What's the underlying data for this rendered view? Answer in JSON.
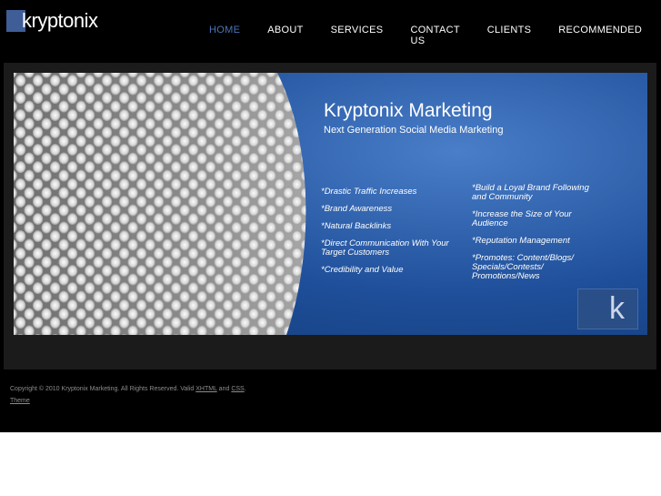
{
  "logo": {
    "text": "kryptonix"
  },
  "nav": {
    "items": [
      {
        "label": "HOME"
      },
      {
        "label": "ABOUT"
      },
      {
        "label": "SERVICES"
      },
      {
        "label": "CONTACT US"
      },
      {
        "label": "CLIENTS"
      },
      {
        "label": "RECOMMENDED"
      }
    ],
    "active": "HOME"
  },
  "banner": {
    "title": "Kryptonix Marketing",
    "subtitle": "Next Generation Social Media Marketing",
    "bullets_left": [
      "*Drastic Traffic Increases",
      "*Brand Awareness",
      "*Natural Backlinks",
      "*Direct Communication With Your Target Customers",
      "*Credibility and Value"
    ],
    "bullets_right": [
      "*Build a Loyal Brand Following and Community",
      "*Increase the Size of Your Audience",
      "*Reputation Management",
      "*Promotes: Content/Blogs/ Specials/Contests/ Promotions/News"
    ],
    "badge_letter": "k"
  },
  "footer": {
    "copyright": "Copyright © 2010 Kryptonix Marketing. All Rights Reserved. Valid",
    "xhtml": "XHTML",
    "and": "and",
    "css": "CSS",
    "period": ".",
    "theme": "Theme"
  },
  "colors": {
    "accent": "#4c74b8",
    "background": "#000000",
    "panel": "#1b1b1b"
  }
}
